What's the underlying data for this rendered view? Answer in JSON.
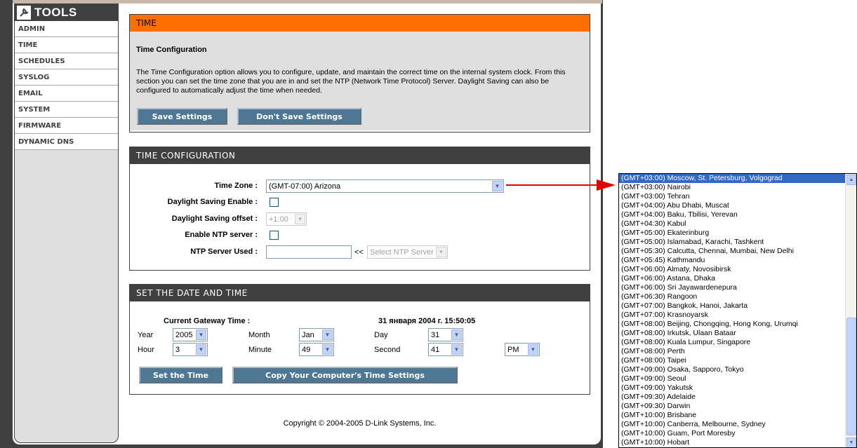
{
  "sidebar": {
    "title": "TOOLS",
    "items": [
      {
        "label": "ADMIN"
      },
      {
        "label": "TIME"
      },
      {
        "label": "SCHEDULES"
      },
      {
        "label": "SYSLOG"
      },
      {
        "label": "EMAIL"
      },
      {
        "label": "SYSTEM"
      },
      {
        "label": "FIRMWARE"
      },
      {
        "label": "DYNAMIC DNS"
      }
    ]
  },
  "intro": {
    "header": "TIME",
    "title": "Time Configuration",
    "text": "The Time Configuration option allows you to configure, update, and maintain the correct time on the internal system clock. From this section you can set the time zone that you are in and set the NTP (Network Time Protocol) Server. Daylight Saving can also be configured to automatically adjust the time when needed.",
    "save_label": "Save Settings",
    "dont_save_label": "Don't Save Settings"
  },
  "time_config": {
    "header": "TIME CONFIGURATION",
    "time_zone_label": "Time Zone :",
    "time_zone_value": "(GMT-07:00) Arizona",
    "dst_enable_label": "Daylight Saving Enable :",
    "dst_offset_label": "Daylight Saving offset :",
    "dst_offset_value": "+1:00",
    "ntp_enable_label": "Enable NTP server :",
    "ntp_used_label": "NTP Server Used :",
    "ntp_arrows": "<<",
    "ntp_select_value": "Select NTP Server"
  },
  "date_time": {
    "header": "SET THE DATE AND TIME",
    "gateway_label": "Current Gateway Time :",
    "gateway_value": "31 января 2004 г. 15:50:05",
    "year_label": "Year",
    "year_value": "2005",
    "month_label": "Month",
    "month_value": "Jan",
    "day_label": "Day",
    "day_value": "31",
    "hour_label": "Hour",
    "hour_value": "3",
    "minute_label": "Minute",
    "minute_value": "49",
    "second_label": "Second",
    "second_value": "41",
    "ampm_value": "PM",
    "set_label": "Set the Time",
    "copy_label": "Copy Your Computer's Time Settings"
  },
  "copyright": "Copyright © 2004-2005 D-Link Systems, Inc.",
  "timezone_list": [
    "(GMT+03:00) Moscow, St. Petersburg, Volgograd",
    "(GMT+03:00) Nairobi",
    "(GMT+03:00) Tehran",
    "(GMT+04:00) Abu Dhabi, Muscat",
    "(GMT+04:00) Baku, Tbilisi, Yerevan",
    "(GMT+04:30) Kabul",
    "(GMT+05:00) Ekaterinburg",
    "(GMT+05:00) Islamabad, Karachi, Tashkent",
    "(GMT+05:30) Calcutta, Chennai, Mumbai, New Delhi",
    "(GMT+05:45) Kathmandu",
    "(GMT+06:00) Almaty, Novosibirsk",
    "(GMT+06:00) Astana, Dhaka",
    "(GMT+06:00) Sri Jayawardenepura",
    "(GMT+06:30) Rangoon",
    "(GMT+07:00) Bangkok, Hanoi, Jakarta",
    "(GMT+07:00) Krasnoyarsk",
    "(GMT+08:00) Beijing, Chongqing, Hong Kong, Urumqi",
    "(GMT+08:00) Irkutsk, Ulaan Bataar",
    "(GMT+08:00) Kuala Lumpur, Singapore",
    "(GMT+08:00) Perth",
    "(GMT+08:00) Taipei",
    "(GMT+09:00) Osaka, Sapporo, Tokyo",
    "(GMT+09:00) Seoul",
    "(GMT+09:00) Yakutsk",
    "(GMT+09:30) Adelaide",
    "(GMT+09:30) Darwin",
    "(GMT+10:00) Brisbane",
    "(GMT+10:00) Canberra, Melbourne, Sydney",
    "(GMT+10:00) Guam, Port Moresby",
    "(GMT+10:00) Hobart"
  ],
  "colors": {
    "accent_orange": "#ff6f00",
    "header_dark": "#404040",
    "button_blue": "#4e7794",
    "arrow_red": "#e00000"
  }
}
